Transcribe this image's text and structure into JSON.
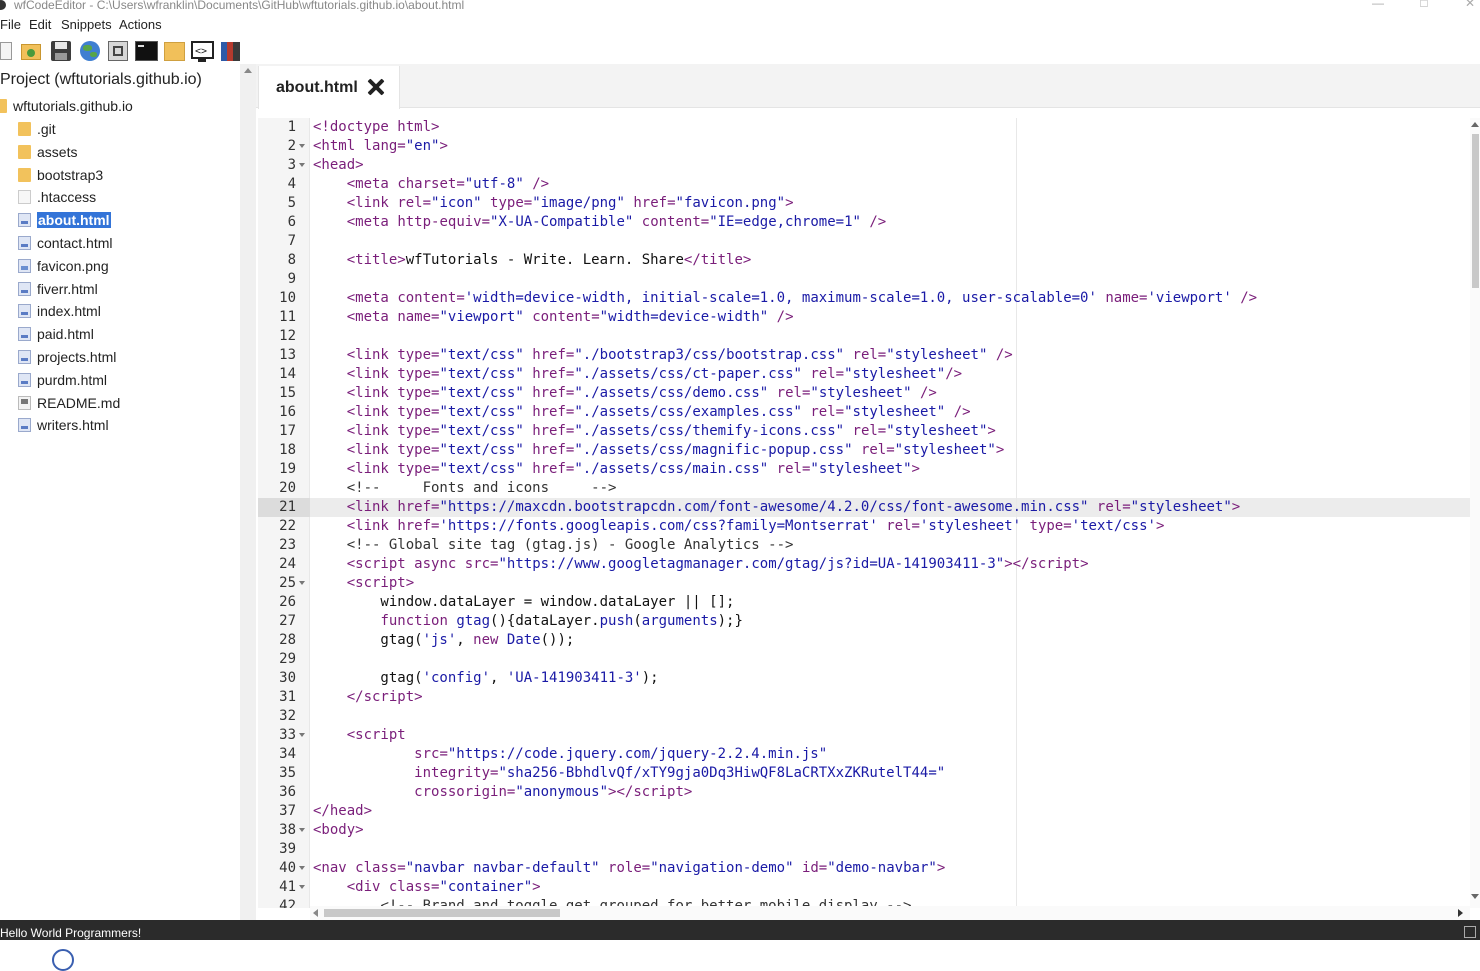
{
  "window": {
    "title": "wfCodeEditor - C:\\Users\\wfranklin\\Documents\\GitHub\\wftutorials.github.io\\about.html"
  },
  "menu": {
    "items": [
      {
        "label": "File"
      },
      {
        "label": "Edit"
      },
      {
        "label": "Snippets"
      },
      {
        "label": "Actions"
      }
    ]
  },
  "toolbar": {
    "icons": [
      "new-file-icon",
      "open-folder-icon",
      "save-icon",
      "browser-globe-icon",
      "fullscreen-icon",
      "terminal-icon",
      "folder-icon",
      "code-view-icon",
      "books-icon"
    ]
  },
  "sidebar": {
    "project_title": "Project (wftutorials.github.io)",
    "root": "wftutorials.github.io",
    "items": [
      {
        "label": ".git",
        "type": "folder"
      },
      {
        "label": "assets",
        "type": "folder"
      },
      {
        "label": "bootstrap3",
        "type": "folder"
      },
      {
        "label": ".htaccess",
        "type": "file"
      },
      {
        "label": "about.html",
        "type": "html",
        "selected": true
      },
      {
        "label": "contact.html",
        "type": "html"
      },
      {
        "label": "favicon.png",
        "type": "png"
      },
      {
        "label": "fiverr.html",
        "type": "html"
      },
      {
        "label": "index.html",
        "type": "html"
      },
      {
        "label": "paid.html",
        "type": "html"
      },
      {
        "label": "projects.html",
        "type": "html"
      },
      {
        "label": "purdm.html",
        "type": "html"
      },
      {
        "label": "README.md",
        "type": "md"
      },
      {
        "label": "writers.html",
        "type": "html"
      }
    ]
  },
  "editor": {
    "active_tab": "about.html",
    "active_line": 21,
    "lines": [
      {
        "n": "1",
        "fold": false,
        "html": "<span class=\"tag\">&lt;!doctype html&gt;</span>"
      },
      {
        "n": "2",
        "fold": true,
        "html": "<span class=\"tag\">&lt;html</span> <span class=\"attr\">lang=</span><span class=\"str\">\"en\"</span><span class=\"tag\">&gt;</span>"
      },
      {
        "n": "3",
        "fold": true,
        "html": "<span class=\"tag\">&lt;head&gt;</span>"
      },
      {
        "n": "4",
        "fold": false,
        "html": "    <span class=\"tag\">&lt;meta</span> <span class=\"attr\">charset=</span><span class=\"str\">\"utf-8\"</span> <span class=\"tag\">/&gt;</span>"
      },
      {
        "n": "5",
        "fold": false,
        "html": "    <span class=\"tag\">&lt;link</span> <span class=\"attr\">rel=</span><span class=\"str\">\"icon\"</span> <span class=\"attr\">type=</span><span class=\"str\">\"image/png\"</span> <span class=\"attr\">href=</span><span class=\"str\">\"favicon.png\"</span><span class=\"tag\">&gt;</span>"
      },
      {
        "n": "6",
        "fold": false,
        "html": "    <span class=\"tag\">&lt;meta</span> <span class=\"attr\">http-equiv=</span><span class=\"str\">\"X-UA-Compatible\"</span> <span class=\"attr\">content=</span><span class=\"str\">\"IE=edge,chrome=1\"</span> <span class=\"tag\">/&gt;</span>"
      },
      {
        "n": "7",
        "fold": false,
        "html": ""
      },
      {
        "n": "8",
        "fold": false,
        "html": "    <span class=\"tag\">&lt;title&gt;</span>wfTutorials - Write. Learn. Share<span class=\"tag\">&lt;/title&gt;</span>"
      },
      {
        "n": "9",
        "fold": false,
        "html": ""
      },
      {
        "n": "10",
        "fold": false,
        "html": "    <span class=\"tag\">&lt;meta</span> <span class=\"attr\">content=</span><span class=\"str\">'width=device-width, initial-scale=1.0, maximum-scale=1.0, user-scalable=0'</span> <span class=\"attr\">name=</span><span class=\"str\">'viewport'</span> <span class=\"tag\">/&gt;</span>"
      },
      {
        "n": "11",
        "fold": false,
        "html": "    <span class=\"tag\">&lt;meta</span> <span class=\"attr\">name=</span><span class=\"str\">\"viewport\"</span> <span class=\"attr\">content=</span><span class=\"str\">\"width=device-width\"</span> <span class=\"tag\">/&gt;</span>"
      },
      {
        "n": "12",
        "fold": false,
        "html": ""
      },
      {
        "n": "13",
        "fold": false,
        "html": "    <span class=\"tag\">&lt;link</span> <span class=\"attr\">type=</span><span class=\"str\">\"text/css\"</span> <span class=\"attr\">href=</span><span class=\"str\">\"./bootstrap3/css/bootstrap.css\"</span> <span class=\"attr\">rel=</span><span class=\"str\">\"stylesheet\"</span> <span class=\"tag\">/&gt;</span>"
      },
      {
        "n": "14",
        "fold": false,
        "html": "    <span class=\"tag\">&lt;link</span> <span class=\"attr\">type=</span><span class=\"str\">\"text/css\"</span> <span class=\"attr\">href=</span><span class=\"str\">\"./assets/css/ct-paper.css\"</span> <span class=\"attr\">rel=</span><span class=\"str\">\"stylesheet\"</span><span class=\"tag\">/&gt;</span>"
      },
      {
        "n": "15",
        "fold": false,
        "html": "    <span class=\"tag\">&lt;link</span> <span class=\"attr\">type=</span><span class=\"str\">\"text/css\"</span> <span class=\"attr\">href=</span><span class=\"str\">\"./assets/css/demo.css\"</span> <span class=\"attr\">rel=</span><span class=\"str\">\"stylesheet\"</span> <span class=\"tag\">/&gt;</span>"
      },
      {
        "n": "16",
        "fold": false,
        "html": "    <span class=\"tag\">&lt;link</span> <span class=\"attr\">type=</span><span class=\"str\">\"text/css\"</span> <span class=\"attr\">href=</span><span class=\"str\">\"./assets/css/examples.css\"</span> <span class=\"attr\">rel=</span><span class=\"str\">\"stylesheet\"</span> <span class=\"tag\">/&gt;</span>"
      },
      {
        "n": "17",
        "fold": false,
        "html": "    <span class=\"tag\">&lt;link</span> <span class=\"attr\">type=</span><span class=\"str\">\"text/css\"</span> <span class=\"attr\">href=</span><span class=\"str\">\"./assets/css/themify-icons.css\"</span> <span class=\"attr\">rel=</span><span class=\"str\">\"stylesheet\"</span><span class=\"tag\">&gt;</span>"
      },
      {
        "n": "18",
        "fold": false,
        "html": "    <span class=\"tag\">&lt;link</span> <span class=\"attr\">type=</span><span class=\"str\">\"text/css\"</span> <span class=\"attr\">href=</span><span class=\"str\">\"./assets/css/magnific-popup.css\"</span> <span class=\"attr\">rel=</span><span class=\"str\">\"stylesheet\"</span><span class=\"tag\">&gt;</span>"
      },
      {
        "n": "19",
        "fold": false,
        "html": "    <span class=\"tag\">&lt;link</span> <span class=\"attr\">type=</span><span class=\"str\">\"text/css\"</span> <span class=\"attr\">href=</span><span class=\"str\">\"./assets/css/main.css\"</span> <span class=\"attr\">rel=</span><span class=\"str\">\"stylesheet\"</span><span class=\"tag\">&gt;</span>"
      },
      {
        "n": "20",
        "fold": false,
        "html": "    <span class=\"cm\">&lt;!--     Fonts and icons     --&gt;</span>"
      },
      {
        "n": "21",
        "fold": false,
        "html": "    <span class=\"tag\">&lt;link</span> <span class=\"attr\">href=</span><span class=\"str\">\"https://maxcdn.bootstrapcdn.com/font-awesome/4.2.0/css/font-awesome.min.css\"</span> <span class=\"attr\">rel=</span><span class=\"str\">\"stylesheet\"</span><span class=\"tag\">&gt;</span>"
      },
      {
        "n": "22",
        "fold": false,
        "html": "    <span class=\"tag\">&lt;link</span> <span class=\"attr\">href=</span><span class=\"str\">'https://fonts.googleapis.com/css?family=Montserrat'</span> <span class=\"attr\">rel=</span><span class=\"str\">'stylesheet'</span> <span class=\"attr\">type=</span><span class=\"str\">'text/css'</span><span class=\"tag\">&gt;</span>"
      },
      {
        "n": "23",
        "fold": false,
        "html": "    <span class=\"cm\">&lt;!-- Global site tag (gtag.js) - Google Analytics --&gt;</span>"
      },
      {
        "n": "24",
        "fold": false,
        "html": "    <span class=\"tag\">&lt;script</span> <span class=\"attr\">async</span> <span class=\"attr\">src=</span><span class=\"str\">\"https://www.googletagmanager.com/gtag/js?id=UA-141903411-3\"</span><span class=\"tag\">&gt;&lt;/script&gt;</span>"
      },
      {
        "n": "25",
        "fold": true,
        "html": "    <span class=\"tag\">&lt;script&gt;</span>"
      },
      {
        "n": "26",
        "fold": false,
        "html": "        window.dataLayer = window.dataLayer || [];"
      },
      {
        "n": "27",
        "fold": false,
        "html": "        <span class=\"kw\">function</span> <span class=\"fn\">gtag</span>(){dataLayer.<span class=\"fn\">push</span>(<span class=\"fn\">arguments</span>);}"
      },
      {
        "n": "28",
        "fold": false,
        "html": "        gtag(<span class=\"str\">'js'</span>, <span class=\"kw\">new</span> <span class=\"fn\">Date</span>());"
      },
      {
        "n": "29",
        "fold": false,
        "html": ""
      },
      {
        "n": "30",
        "fold": false,
        "html": "        gtag(<span class=\"str\">'config'</span>, <span class=\"str\">'UA-141903411-3'</span>);"
      },
      {
        "n": "31",
        "fold": false,
        "html": "    <span class=\"tag\">&lt;/script&gt;</span>"
      },
      {
        "n": "32",
        "fold": false,
        "html": ""
      },
      {
        "n": "33",
        "fold": true,
        "html": "    <span class=\"tag\">&lt;script</span>"
      },
      {
        "n": "34",
        "fold": false,
        "html": "            <span class=\"attr\">src=</span><span class=\"str\">\"https://code.jquery.com/jquery-2.2.4.min.js\"</span>"
      },
      {
        "n": "35",
        "fold": false,
        "html": "            <span class=\"attr\">integrity=</span><span class=\"str\">\"sha256-BbhdlvQf/xTY9gja0Dq3HiwQF8LaCRTXxZKRutelT44=\"</span>"
      },
      {
        "n": "36",
        "fold": false,
        "html": "            <span class=\"attr\">crossorigin=</span><span class=\"str\">\"anonymous\"</span><span class=\"tag\">&gt;&lt;/script&gt;</span>"
      },
      {
        "n": "37",
        "fold": false,
        "html": "<span class=\"tag\">&lt;/head&gt;</span>"
      },
      {
        "n": "38",
        "fold": true,
        "html": "<span class=\"tag\">&lt;body&gt;</span>"
      },
      {
        "n": "39",
        "fold": false,
        "html": ""
      },
      {
        "n": "40",
        "fold": true,
        "html": "<span class=\"tag\">&lt;nav</span> <span class=\"attr\">class=</span><span class=\"str\">\"navbar navbar-default\"</span> <span class=\"attr\">role=</span><span class=\"str\">\"navigation-demo\"</span> <span class=\"attr\">id=</span><span class=\"str\">\"demo-navbar\"</span><span class=\"tag\">&gt;</span>"
      },
      {
        "n": "41",
        "fold": true,
        "html": "    <span class=\"tag\">&lt;div</span> <span class=\"attr\">class=</span><span class=\"str\">\"container\"</span><span class=\"tag\">&gt;</span>"
      },
      {
        "n": "42",
        "fold": false,
        "html": "        <span class=\"cm\">&lt;!-- Brand and toggle get grouped for better mobile display --&gt;</span>"
      }
    ]
  },
  "status": {
    "text": "Hello World Programmers!"
  }
}
